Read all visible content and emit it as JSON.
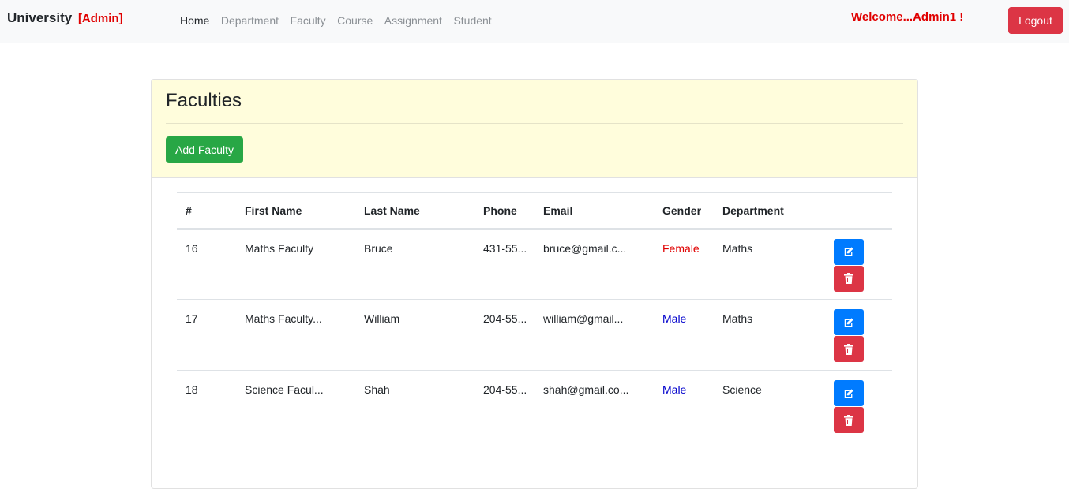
{
  "navbar": {
    "brand": "University",
    "role": "[Admin]",
    "links": [
      "Home",
      "Department",
      "Faculty",
      "Course",
      "Assignment",
      "Student"
    ],
    "welcome": "Welcome...Admin1 !",
    "logout_label": "Logout"
  },
  "page": {
    "title": "Faculties",
    "add_button": "Add Faculty"
  },
  "table": {
    "columns": [
      "#",
      "First Name",
      "Last Name",
      "Phone",
      "Email",
      "Gender",
      "Department"
    ],
    "rows": [
      {
        "id": "16",
        "first_name": "Maths Faculty",
        "last_name": "Bruce",
        "phone": "431-55...",
        "email": "bruce@gmail.c...",
        "gender": "Female",
        "department": "Maths"
      },
      {
        "id": "17",
        "first_name": "Maths Faculty...",
        "last_name": "William",
        "phone": "204-55...",
        "email": "william@gmail...",
        "gender": "Male",
        "department": "Maths"
      },
      {
        "id": "18",
        "first_name": "Science Facul...",
        "last_name": "Shah",
        "phone": "204-55...",
        "email": "shah@gmail.co...",
        "gender": "Male",
        "department": "Science"
      }
    ]
  },
  "colors": {
    "brand_red": "#e00000",
    "danger": "#dc3545",
    "success": "#28a745",
    "primary": "#007bff",
    "header_bg": "#fffddc"
  },
  "icons": {
    "edit": "edit-icon",
    "delete": "trash-icon"
  }
}
